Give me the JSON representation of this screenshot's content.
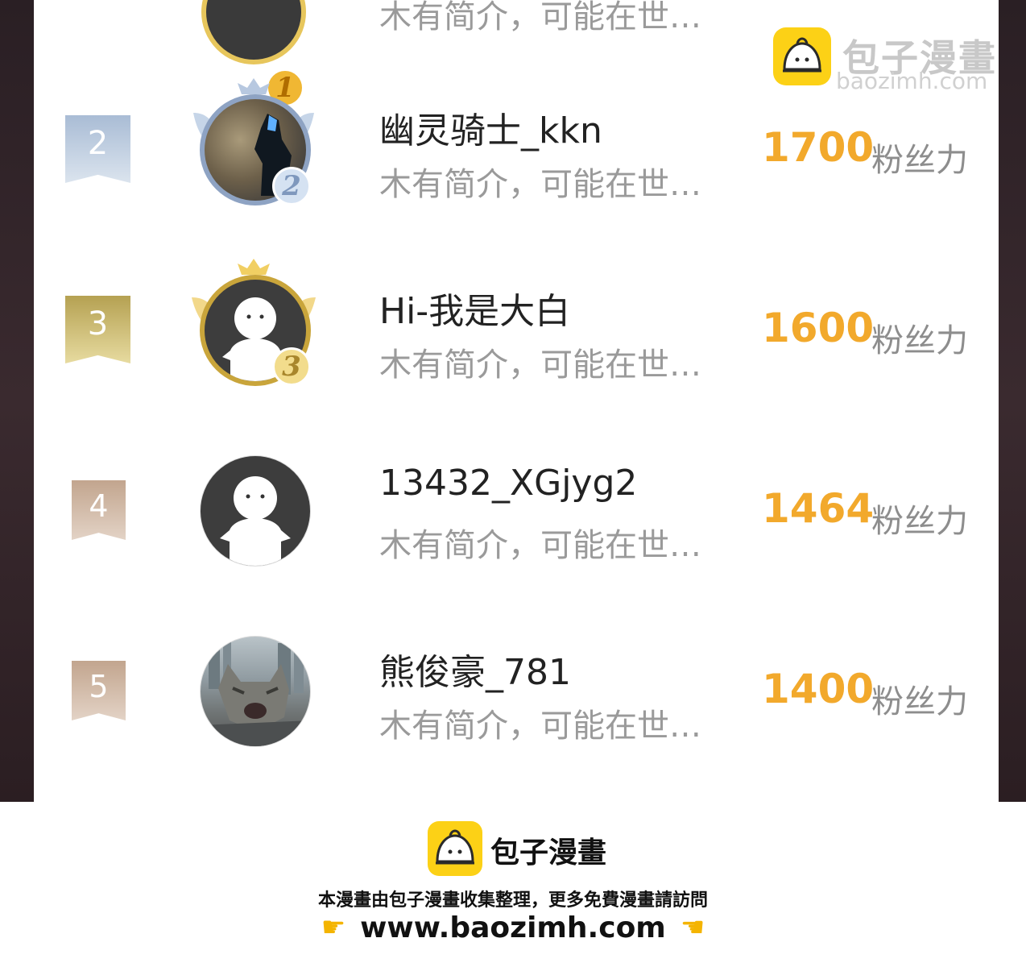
{
  "watermark": {
    "title": "包子漫畫",
    "url": "baozimh.com"
  },
  "leaderboard": [
    {
      "rank": "",
      "name": "",
      "intro": "木有简介，可能在世…",
      "score": "",
      "unit": "",
      "medal": "1"
    },
    {
      "rank": "2",
      "name": "幽灵骑士_kkn",
      "intro": "木有简介，可能在世…",
      "score": "1700",
      "unit": "粉丝力",
      "medal": "2"
    },
    {
      "rank": "3",
      "name": "Hi-我是大白",
      "intro": "木有简介，可能在世…",
      "score": "1600",
      "unit": "粉丝力",
      "medal": "3"
    },
    {
      "rank": "4",
      "name": "13432_XGjyg2",
      "intro": "木有简介，可能在世…",
      "score": "1464",
      "unit": "粉丝力"
    },
    {
      "rank": "5",
      "name": "熊俊豪_781",
      "intro": "木有简介，可能在世…",
      "score": "1400",
      "unit": "粉丝力"
    }
  ],
  "footer": {
    "title": "包子漫畫",
    "note": "本漫畫由包子漫畫收集整理，更多免費漫畫請訪問",
    "url": "www.baozimh.com"
  },
  "colors": {
    "score": "#f2a92c",
    "badge_silver": "#b8c7db",
    "badge_gold": "#c9b56a",
    "badge_bronze": "#c9b3a0",
    "logo_yellow": "#fcd116"
  }
}
